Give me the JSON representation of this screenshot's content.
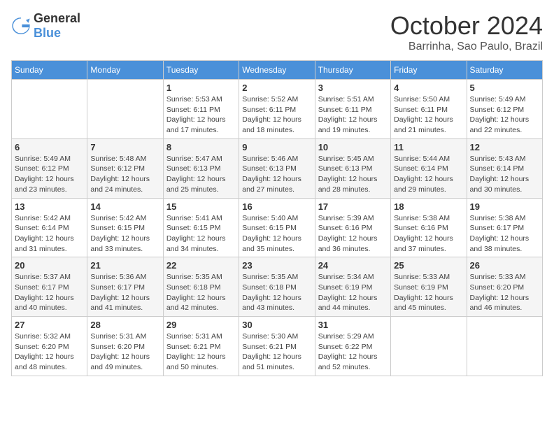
{
  "header": {
    "logo_general": "General",
    "logo_blue": "Blue",
    "month_year": "October 2024",
    "location": "Barrinha, Sao Paulo, Brazil"
  },
  "calendar": {
    "columns": [
      "Sunday",
      "Monday",
      "Tuesday",
      "Wednesday",
      "Thursday",
      "Friday",
      "Saturday"
    ],
    "weeks": [
      [
        {
          "day": "",
          "sunrise": "",
          "sunset": "",
          "daylight": ""
        },
        {
          "day": "",
          "sunrise": "",
          "sunset": "",
          "daylight": ""
        },
        {
          "day": "1",
          "sunrise": "Sunrise: 5:53 AM",
          "sunset": "Sunset: 6:11 PM",
          "daylight": "Daylight: 12 hours and 17 minutes."
        },
        {
          "day": "2",
          "sunrise": "Sunrise: 5:52 AM",
          "sunset": "Sunset: 6:11 PM",
          "daylight": "Daylight: 12 hours and 18 minutes."
        },
        {
          "day": "3",
          "sunrise": "Sunrise: 5:51 AM",
          "sunset": "Sunset: 6:11 PM",
          "daylight": "Daylight: 12 hours and 19 minutes."
        },
        {
          "day": "4",
          "sunrise": "Sunrise: 5:50 AM",
          "sunset": "Sunset: 6:11 PM",
          "daylight": "Daylight: 12 hours and 21 minutes."
        },
        {
          "day": "5",
          "sunrise": "Sunrise: 5:49 AM",
          "sunset": "Sunset: 6:12 PM",
          "daylight": "Daylight: 12 hours and 22 minutes."
        }
      ],
      [
        {
          "day": "6",
          "sunrise": "Sunrise: 5:49 AM",
          "sunset": "Sunset: 6:12 PM",
          "daylight": "Daylight: 12 hours and 23 minutes."
        },
        {
          "day": "7",
          "sunrise": "Sunrise: 5:48 AM",
          "sunset": "Sunset: 6:12 PM",
          "daylight": "Daylight: 12 hours and 24 minutes."
        },
        {
          "day": "8",
          "sunrise": "Sunrise: 5:47 AM",
          "sunset": "Sunset: 6:13 PM",
          "daylight": "Daylight: 12 hours and 25 minutes."
        },
        {
          "day": "9",
          "sunrise": "Sunrise: 5:46 AM",
          "sunset": "Sunset: 6:13 PM",
          "daylight": "Daylight: 12 hours and 27 minutes."
        },
        {
          "day": "10",
          "sunrise": "Sunrise: 5:45 AM",
          "sunset": "Sunset: 6:13 PM",
          "daylight": "Daylight: 12 hours and 28 minutes."
        },
        {
          "day": "11",
          "sunrise": "Sunrise: 5:44 AM",
          "sunset": "Sunset: 6:14 PM",
          "daylight": "Daylight: 12 hours and 29 minutes."
        },
        {
          "day": "12",
          "sunrise": "Sunrise: 5:43 AM",
          "sunset": "Sunset: 6:14 PM",
          "daylight": "Daylight: 12 hours and 30 minutes."
        }
      ],
      [
        {
          "day": "13",
          "sunrise": "Sunrise: 5:42 AM",
          "sunset": "Sunset: 6:14 PM",
          "daylight": "Daylight: 12 hours and 31 minutes."
        },
        {
          "day": "14",
          "sunrise": "Sunrise: 5:42 AM",
          "sunset": "Sunset: 6:15 PM",
          "daylight": "Daylight: 12 hours and 33 minutes."
        },
        {
          "day": "15",
          "sunrise": "Sunrise: 5:41 AM",
          "sunset": "Sunset: 6:15 PM",
          "daylight": "Daylight: 12 hours and 34 minutes."
        },
        {
          "day": "16",
          "sunrise": "Sunrise: 5:40 AM",
          "sunset": "Sunset: 6:15 PM",
          "daylight": "Daylight: 12 hours and 35 minutes."
        },
        {
          "day": "17",
          "sunrise": "Sunrise: 5:39 AM",
          "sunset": "Sunset: 6:16 PM",
          "daylight": "Daylight: 12 hours and 36 minutes."
        },
        {
          "day": "18",
          "sunrise": "Sunrise: 5:38 AM",
          "sunset": "Sunset: 6:16 PM",
          "daylight": "Daylight: 12 hours and 37 minutes."
        },
        {
          "day": "19",
          "sunrise": "Sunrise: 5:38 AM",
          "sunset": "Sunset: 6:17 PM",
          "daylight": "Daylight: 12 hours and 38 minutes."
        }
      ],
      [
        {
          "day": "20",
          "sunrise": "Sunrise: 5:37 AM",
          "sunset": "Sunset: 6:17 PM",
          "daylight": "Daylight: 12 hours and 40 minutes."
        },
        {
          "day": "21",
          "sunrise": "Sunrise: 5:36 AM",
          "sunset": "Sunset: 6:17 PM",
          "daylight": "Daylight: 12 hours and 41 minutes."
        },
        {
          "day": "22",
          "sunrise": "Sunrise: 5:35 AM",
          "sunset": "Sunset: 6:18 PM",
          "daylight": "Daylight: 12 hours and 42 minutes."
        },
        {
          "day": "23",
          "sunrise": "Sunrise: 5:35 AM",
          "sunset": "Sunset: 6:18 PM",
          "daylight": "Daylight: 12 hours and 43 minutes."
        },
        {
          "day": "24",
          "sunrise": "Sunrise: 5:34 AM",
          "sunset": "Sunset: 6:19 PM",
          "daylight": "Daylight: 12 hours and 44 minutes."
        },
        {
          "day": "25",
          "sunrise": "Sunrise: 5:33 AM",
          "sunset": "Sunset: 6:19 PM",
          "daylight": "Daylight: 12 hours and 45 minutes."
        },
        {
          "day": "26",
          "sunrise": "Sunrise: 5:33 AM",
          "sunset": "Sunset: 6:20 PM",
          "daylight": "Daylight: 12 hours and 46 minutes."
        }
      ],
      [
        {
          "day": "27",
          "sunrise": "Sunrise: 5:32 AM",
          "sunset": "Sunset: 6:20 PM",
          "daylight": "Daylight: 12 hours and 48 minutes."
        },
        {
          "day": "28",
          "sunrise": "Sunrise: 5:31 AM",
          "sunset": "Sunset: 6:20 PM",
          "daylight": "Daylight: 12 hours and 49 minutes."
        },
        {
          "day": "29",
          "sunrise": "Sunrise: 5:31 AM",
          "sunset": "Sunset: 6:21 PM",
          "daylight": "Daylight: 12 hours and 50 minutes."
        },
        {
          "day": "30",
          "sunrise": "Sunrise: 5:30 AM",
          "sunset": "Sunset: 6:21 PM",
          "daylight": "Daylight: 12 hours and 51 minutes."
        },
        {
          "day": "31",
          "sunrise": "Sunrise: 5:29 AM",
          "sunset": "Sunset: 6:22 PM",
          "daylight": "Daylight: 12 hours and 52 minutes."
        },
        {
          "day": "",
          "sunrise": "",
          "sunset": "",
          "daylight": ""
        },
        {
          "day": "",
          "sunrise": "",
          "sunset": "",
          "daylight": ""
        }
      ]
    ]
  }
}
